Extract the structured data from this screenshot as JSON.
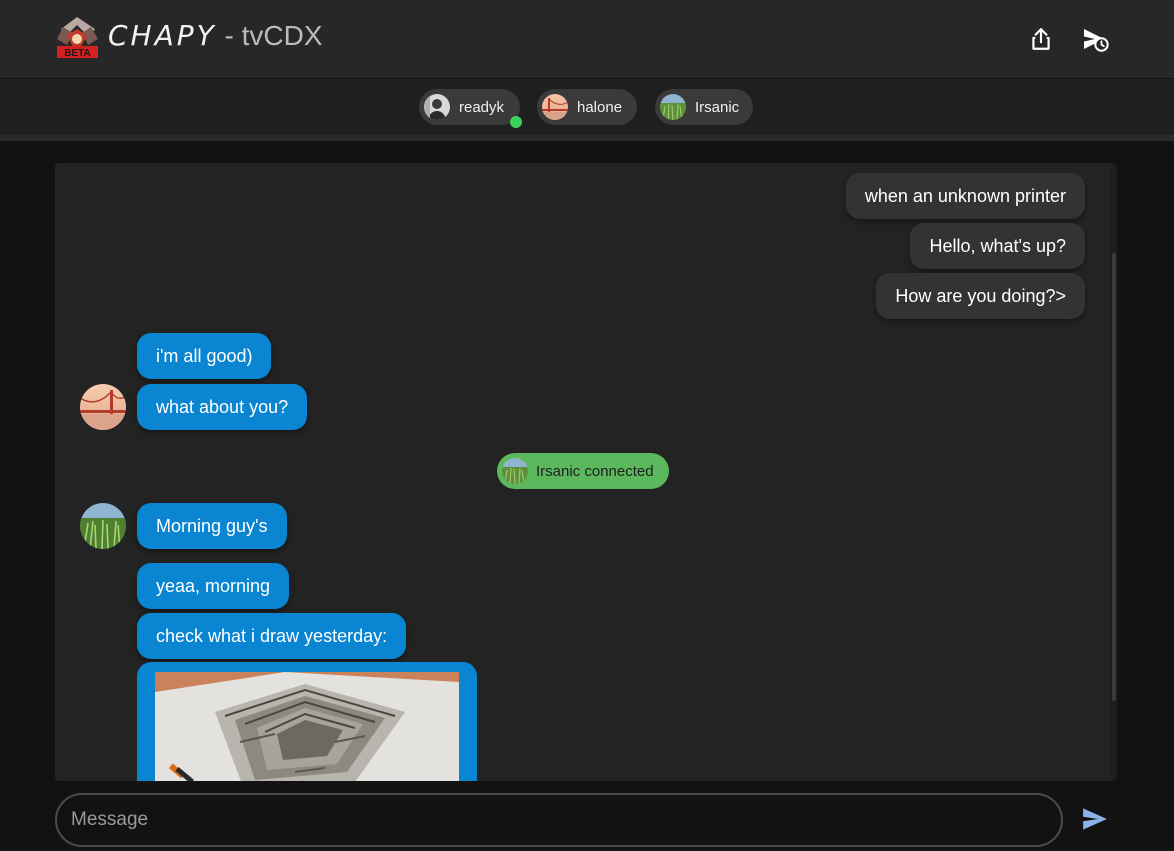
{
  "header": {
    "brand": "CHAPY",
    "separator": " - ",
    "room_code": "tvCDX",
    "logo_badge": "BETA",
    "share_icon": "share-icon",
    "history_icon": "chat-history-icon"
  },
  "users": [
    {
      "name": "readyk",
      "online": true,
      "avatar": "avatar-photo"
    },
    {
      "name": "halone",
      "online": false,
      "avatar": "bridge-photo"
    },
    {
      "name": "Irsanic",
      "online": false,
      "avatar": "grass-photo"
    }
  ],
  "messages": {
    "own": [
      "when an unknown printer",
      "Hello, what's up?",
      "How are you doing?>"
    ],
    "halone": [
      "i'm all good)",
      "what about you?"
    ],
    "system": "Irsanic connected",
    "irsanic": [
      "Morning guy's",
      "yeaa, morning",
      "check what i draw yesterday:"
    ]
  },
  "composer": {
    "placeholder": "Message",
    "send_icon": "send-icon"
  },
  "colors": {
    "accent_bubble": "#0a85d1",
    "own_bubble": "#333333",
    "system_pill": "#5cb85c",
    "online_dot": "#3ccf5a"
  }
}
